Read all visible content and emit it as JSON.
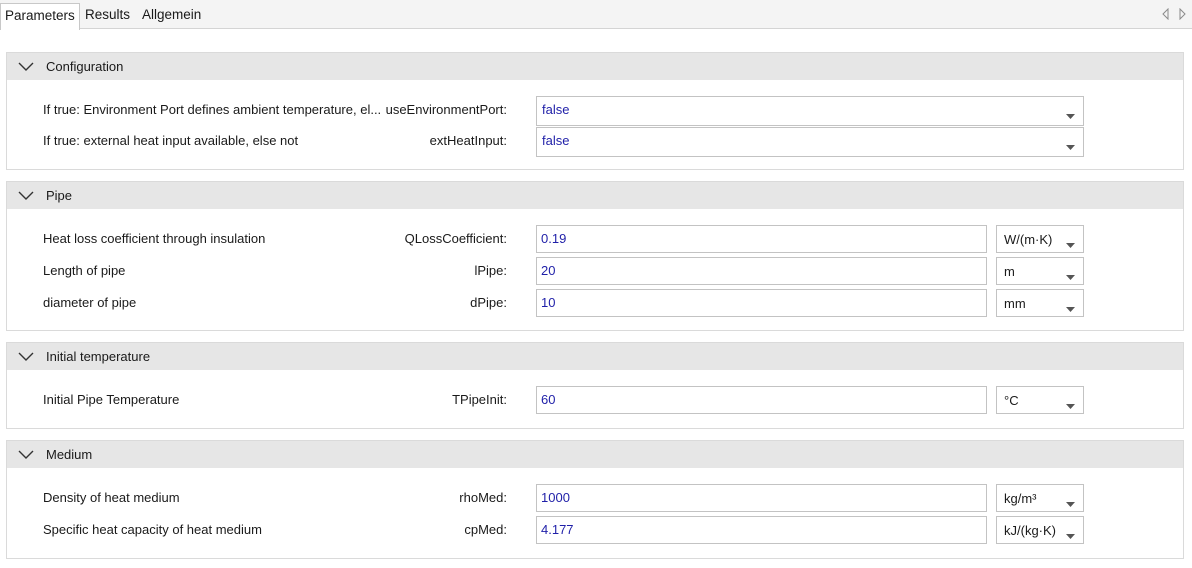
{
  "tabs": [
    {
      "label": "Parameters",
      "active": true
    },
    {
      "label": "Results",
      "active": false
    },
    {
      "label": "Allgemein",
      "active": false
    }
  ],
  "tab_nav": {
    "prev_icon": "triangle-left-icon",
    "next_icon": "triangle-right-icon"
  },
  "colors": {
    "header_bg": "#e6e6e6",
    "value_text": "#1f1fa8",
    "border": "#c3c3c3"
  },
  "sections": {
    "configuration": {
      "title": "Configuration",
      "rows": [
        {
          "description": "If true: Environment Port defines ambient temperature, el...",
          "param": "useEnvironmentPort:",
          "value": "false"
        },
        {
          "description": "If true: external heat input available, else not",
          "param": "extHeatInput:",
          "value": "false"
        }
      ]
    },
    "pipe": {
      "title": "Pipe",
      "rows": [
        {
          "description": "Heat loss coefficient through insulation",
          "param": "QLossCoefficient:",
          "value": "0.19",
          "unit": "W/(m·K)"
        },
        {
          "description": "Length of pipe",
          "param": "lPipe:",
          "value": "20",
          "unit": "m"
        },
        {
          "description": "diameter of pipe",
          "param": "dPipe:",
          "value": "10",
          "unit": "mm"
        }
      ]
    },
    "initial_temperature": {
      "title": "Initial temperature",
      "rows": [
        {
          "description": "Initial Pipe Temperature",
          "param": "TPipeInit:",
          "value": "60",
          "unit": "°C"
        }
      ]
    },
    "medium": {
      "title": "Medium",
      "rows": [
        {
          "description": "Density of heat medium",
          "param": "rhoMed:",
          "value": "1000",
          "unit": "kg/m³"
        },
        {
          "description": "Specific heat capacity of heat medium",
          "param": "cpMed:",
          "value": "4.177",
          "unit": "kJ/(kg·K)"
        }
      ]
    }
  }
}
